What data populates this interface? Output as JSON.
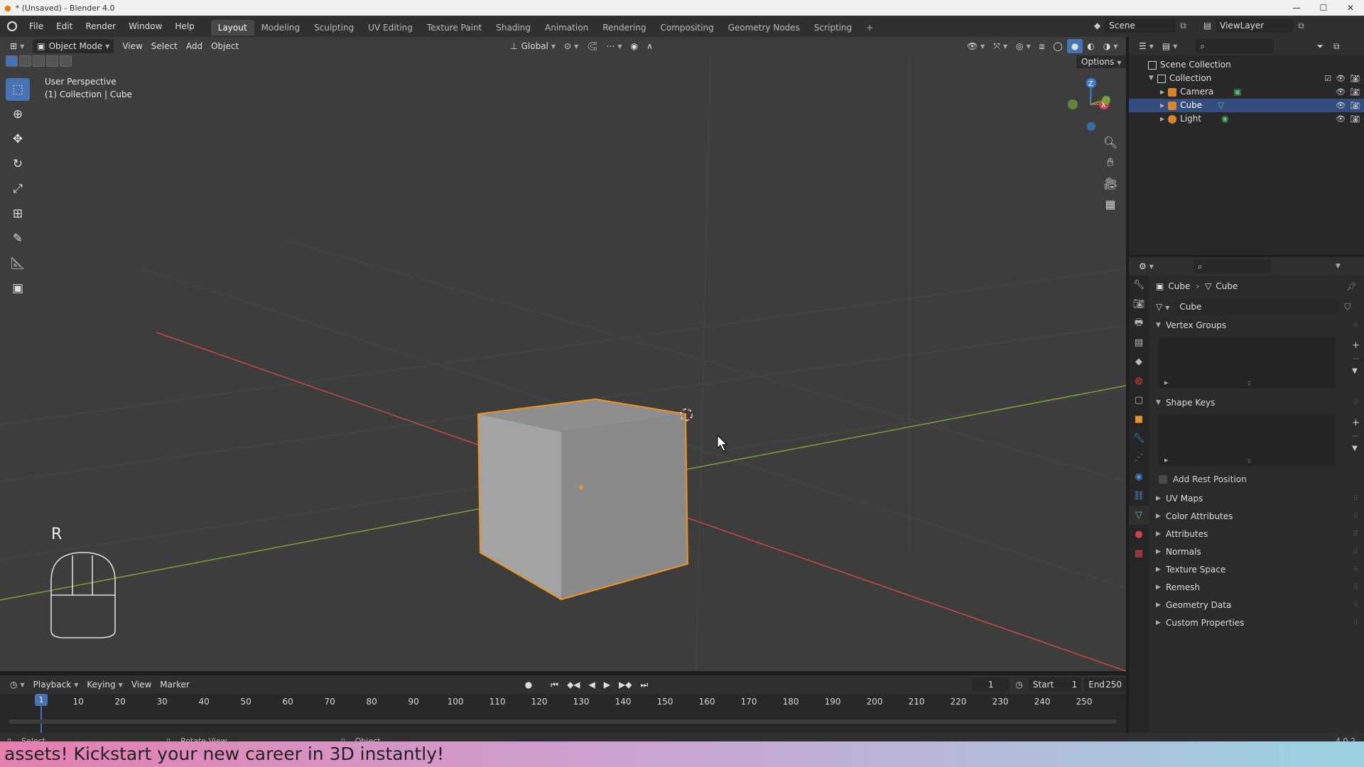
{
  "window": {
    "title": "* (Unsaved) - Blender 4.0"
  },
  "menu": [
    "File",
    "Edit",
    "Render",
    "Window",
    "Help"
  ],
  "workspaces": [
    "Layout",
    "Modeling",
    "Sculpting",
    "UV Editing",
    "Texture Paint",
    "Shading",
    "Animation",
    "Rendering",
    "Compositing",
    "Geometry Nodes",
    "Scripting"
  ],
  "workspace_active": "Layout",
  "scene": {
    "name": "Scene",
    "view_layer": "ViewLayer"
  },
  "viewport": {
    "mode": "Object Mode",
    "menus": [
      "View",
      "Select",
      "Add",
      "Object"
    ],
    "transform_orientation": "Global",
    "options_label": "Options",
    "info_line1": "User Perspective",
    "info_line2": "(1) Collection | Cube",
    "key_hint": "R",
    "gizmo_axes": [
      "Z",
      "X",
      "Y"
    ]
  },
  "outliner": {
    "root": "Scene Collection",
    "collection": "Collection",
    "items": [
      {
        "label": "Camera",
        "selected": false
      },
      {
        "label": "Cube",
        "selected": true
      },
      {
        "label": "Light",
        "selected": false
      }
    ]
  },
  "properties": {
    "breadcrumb_object": "Cube",
    "breadcrumb_data": "Cube",
    "datablock_name": "Cube",
    "panels_open": [
      "Vertex Groups",
      "Shape Keys"
    ],
    "add_rest_position": "Add Rest Position",
    "panels_closed": [
      "UV Maps",
      "Color Attributes",
      "Attributes",
      "Normals",
      "Texture Space",
      "Remesh",
      "Geometry Data",
      "Custom Properties"
    ]
  },
  "timeline": {
    "menus": [
      "Playback",
      "Keying",
      "View",
      "Marker"
    ],
    "current_frame": "1",
    "start_label": "Start",
    "start": "1",
    "end_label": "End",
    "end": "250",
    "ticks": [
      "10",
      "20",
      "30",
      "40",
      "50",
      "60",
      "70",
      "80",
      "90",
      "100",
      "110",
      "120",
      "130",
      "140",
      "150",
      "160",
      "170",
      "180",
      "190",
      "200",
      "210",
      "220",
      "230",
      "240",
      "250"
    ]
  },
  "statusbar": {
    "select": "Select",
    "rotate": "Rotate View",
    "object": "Object",
    "version": "4.0.2"
  },
  "banner": {
    "text": "assets! Kickstart your new career in 3D instantly!"
  },
  "colors": {
    "accent": "#4772b3",
    "selection_outline": "#f0921c",
    "x_axis": "#c74a4a",
    "y_axis": "#7aa23a",
    "z_axis": "#3f7fd6"
  }
}
